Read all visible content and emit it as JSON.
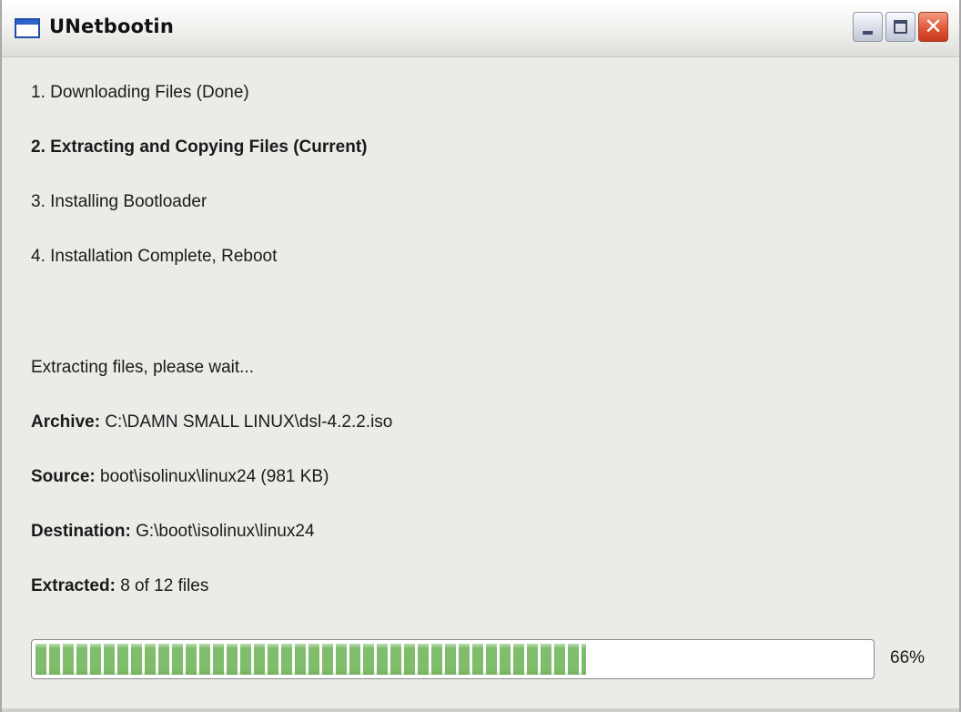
{
  "window": {
    "title": "UNetbootin",
    "minimize_icon": "minimize-icon",
    "maximize_icon": "maximize-icon",
    "close_icon": "close-icon",
    "close_glyph": "✕"
  },
  "steps": [
    {
      "text": "1. Downloading Files (Done)",
      "current": false
    },
    {
      "text": "2. Extracting and Copying Files (Current)",
      "current": true
    },
    {
      "text": "3. Installing Bootloader",
      "current": false
    },
    {
      "text": "4. Installation Complete, Reboot",
      "current": false
    }
  ],
  "status": {
    "message": "Extracting files, please wait...",
    "archive_label": "Archive:",
    "archive_value": "C:\\DAMN SMALL LINUX\\dsl-4.2.2.iso",
    "source_label": "Source:",
    "source_value": "boot\\isolinux\\linux24 (981 KB)",
    "destination_label": "Destination:",
    "destination_value": "G:\\boot\\isolinux\\linux24",
    "extracted_label": "Extracted:",
    "extracted_value": "8 of 12 files"
  },
  "progress": {
    "percent": 66,
    "label": "66%",
    "fill_color": "#7fbd6a"
  }
}
